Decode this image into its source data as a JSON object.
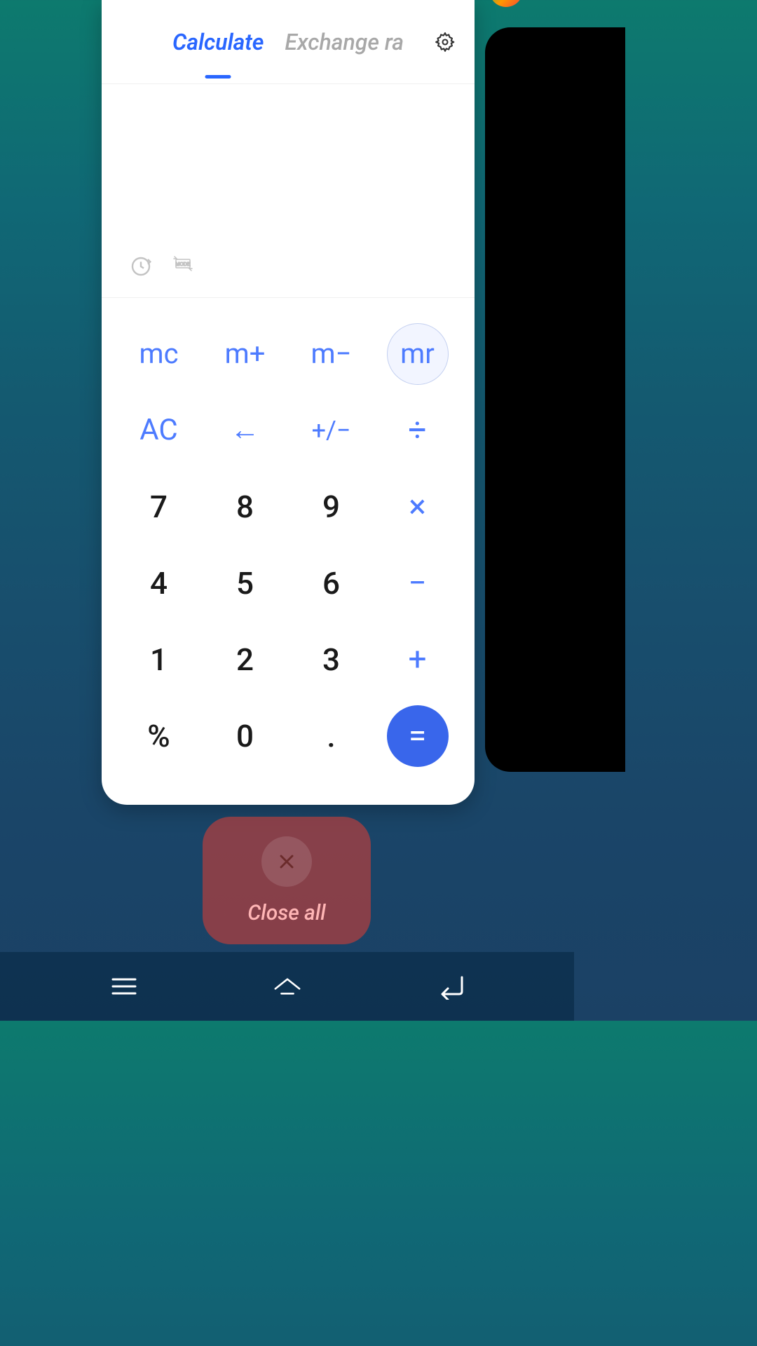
{
  "header": {
    "tab_active": "Calculate",
    "tab_inactive": "Exchange ra"
  },
  "memory": {
    "mc": "mc",
    "mplus": "m+",
    "mminus": "m−",
    "mr": "mr"
  },
  "functions": {
    "ac": "AC",
    "backspace": "←",
    "plusminus": "+/−",
    "divide": "÷"
  },
  "numbers": {
    "n7": "7",
    "n8": "8",
    "n9": "9",
    "n4": "4",
    "n5": "5",
    "n6": "6",
    "n1": "1",
    "n2": "2",
    "n3": "3",
    "percent": "%",
    "n0": "0",
    "dot": "."
  },
  "operators": {
    "multiply": "×",
    "minus": "−",
    "plus": "+",
    "equals": "="
  },
  "closeAll": {
    "label": "Close all"
  }
}
